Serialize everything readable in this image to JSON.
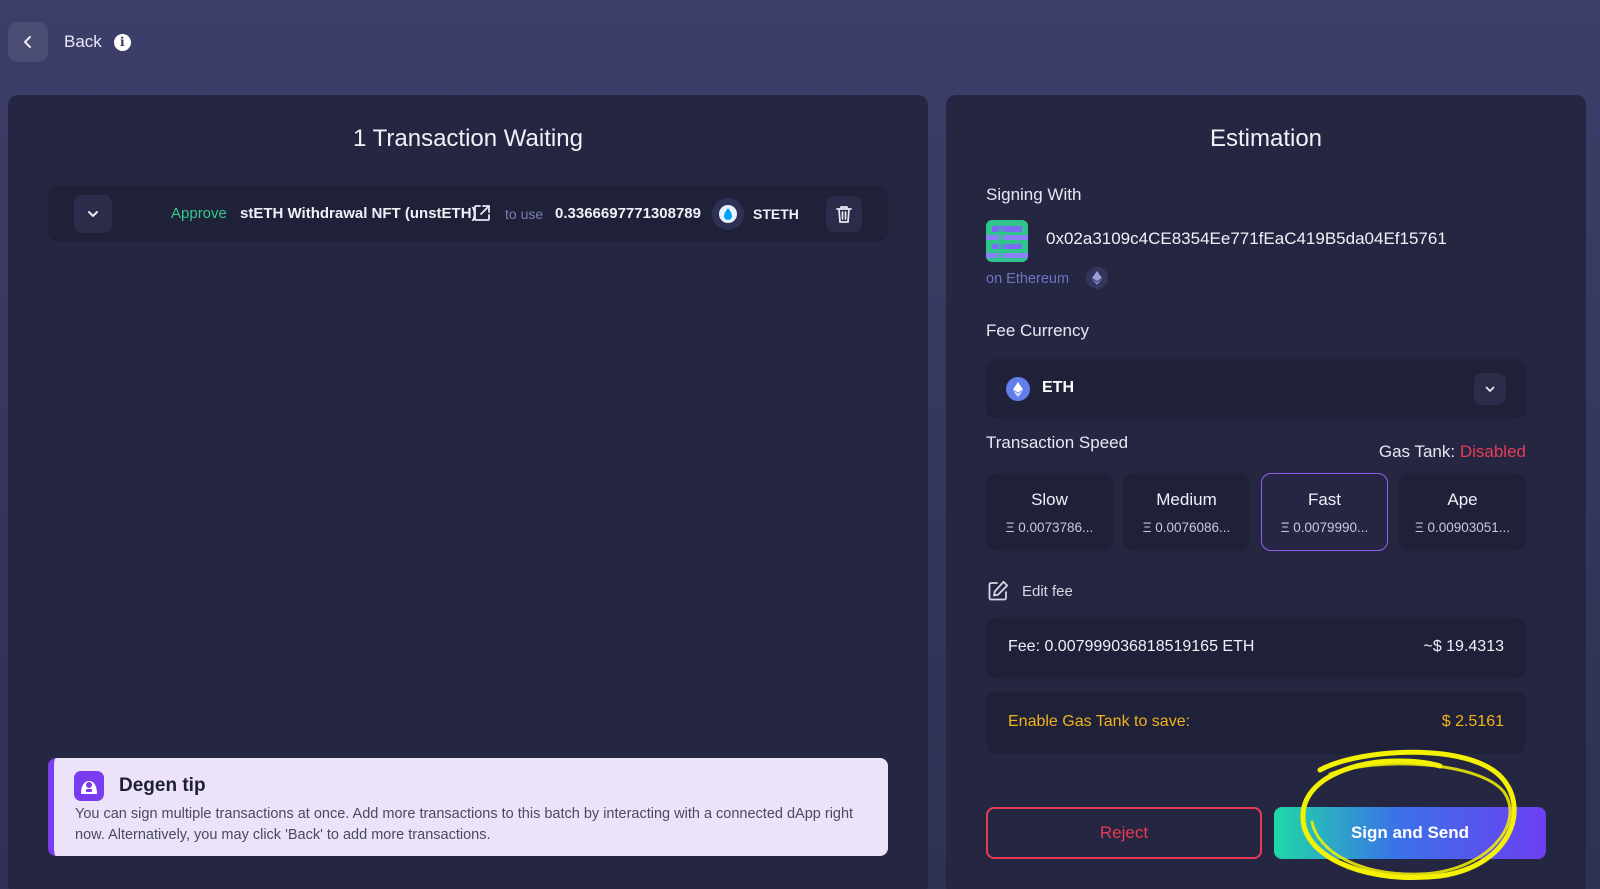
{
  "topbar": {
    "back_label": "Back"
  },
  "left": {
    "title": "1 Transaction Waiting",
    "transaction": {
      "action": "Approve",
      "name": "stETH Withdrawal NFT (unstETH)",
      "to_use_label": "to use",
      "amount": "0.3366697771308789",
      "token": "STETH"
    },
    "tip": {
      "title": "Degen tip",
      "text": "You can sign multiple transactions at once. Add more transactions to this batch by interacting with a connected dApp right now. Alternatively, you may click 'Back' to add more transactions."
    }
  },
  "right": {
    "title": "Estimation",
    "signing_with_label": "Signing With",
    "address": "0x02a3109c4CE8354Ee771fEaC419B5da04Ef15761",
    "network": "on Ethereum",
    "fee_currency_label": "Fee Currency",
    "fee_currency": "ETH",
    "speed_label": "Transaction Speed",
    "gas_tank_label": "Gas Tank:",
    "gas_tank_status": "Disabled",
    "speeds": [
      {
        "name": "Slow",
        "value": "Ξ 0.0073786..."
      },
      {
        "name": "Medium",
        "value": "Ξ 0.0076086..."
      },
      {
        "name": "Fast",
        "value": "Ξ 0.0079990..."
      },
      {
        "name": "Ape",
        "value": "Ξ 0.00903051..."
      }
    ],
    "selected_speed": "Fast",
    "edit_fee_label": "Edit fee",
    "fee_text": "Fee: 0.007999036818519165 ETH",
    "fee_usd": "~$ 19.4313",
    "gas_save_text": "Enable Gas Tank to save:",
    "gas_save_value": "$ 2.5161",
    "reject_label": "Reject",
    "sign_label": "Sign and Send"
  },
  "colors": {
    "approve": "#35c98b",
    "disabled": "#e73a55",
    "gas_save": "#f2b319",
    "selected_border": "#8f63e8",
    "highlight": "#f4f200"
  }
}
